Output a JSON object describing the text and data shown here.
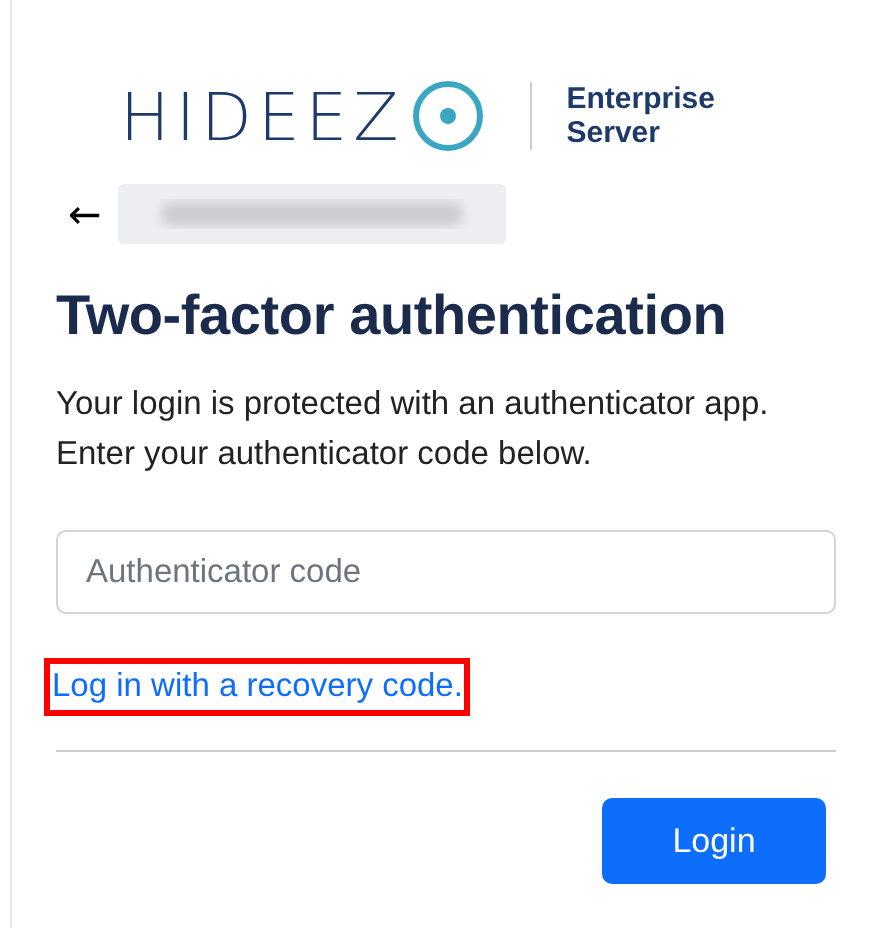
{
  "logo": {
    "wordmark": "HIDEEZ",
    "product": [
      "Enterprise",
      "Server"
    ]
  },
  "back": {
    "icon": "←",
    "email_redacted": true
  },
  "title": "Two-factor authentication",
  "description": "Your login is protected with an authenticator app. Enter your authenticator code below.",
  "code_field": {
    "placeholder": "Authenticator code"
  },
  "recovery_link": {
    "label": "Log in with a recovery code.",
    "highlighted": true
  },
  "buttons": [
    {
      "label": "Login",
      "kind": "primary"
    }
  ]
}
